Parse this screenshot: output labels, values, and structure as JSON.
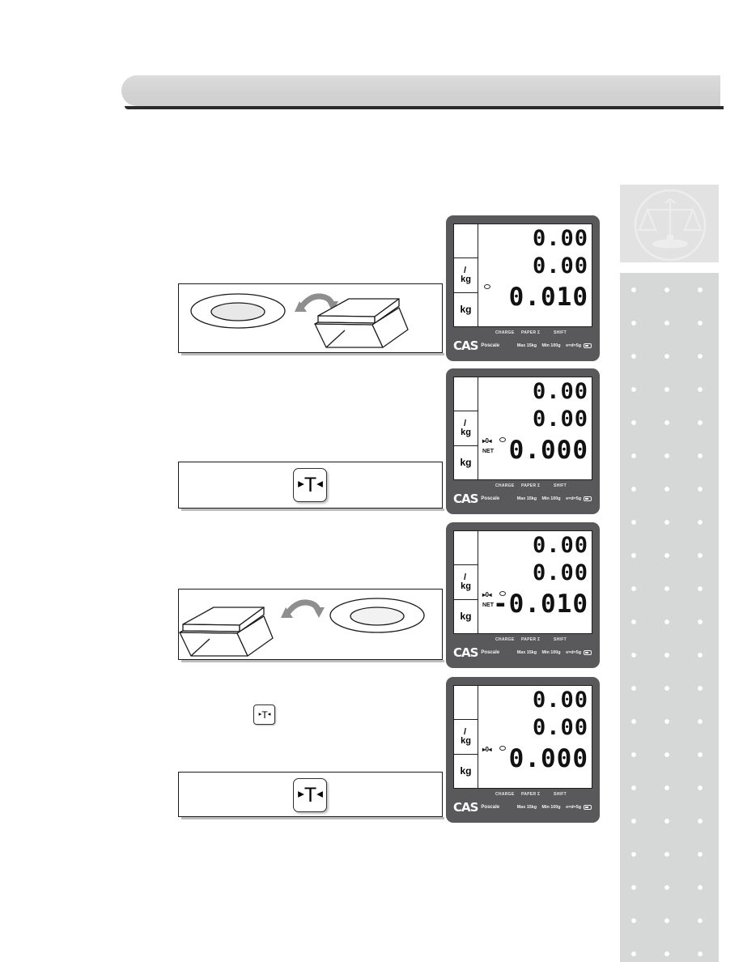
{
  "page": {
    "background_color": "#ffffff",
    "header_bar_color": "#d4d4d4",
    "sidebar_dot_color": "#ffffff",
    "sidebar_background_color": "#d6d8d8"
  },
  "sidebar": {
    "icon_name": "balance-scale-icon",
    "panel_color": "#e2e2e2"
  },
  "steps": [
    {
      "id": "step-1",
      "illustration": "plate-placed-onto-scale",
      "arrow": "curved-arrow-right"
    },
    {
      "id": "step-2",
      "key_label_left": "▸",
      "key_label_center": "T",
      "key_label_right": "◂"
    },
    {
      "id": "step-3",
      "illustration": "plate-removed-from-scale",
      "arrow": "curved-arrow-right"
    },
    {
      "id": "step-4",
      "key_label_left": "▸",
      "key_label_center": "T",
      "key_label_right": "◂"
    }
  ],
  "tare_key_small": {
    "label_left": "▸",
    "label_center": "T",
    "label_right": "◂"
  },
  "scales": [
    {
      "id": "scale-display-1",
      "units": {
        "top": "",
        "middle_slash": "/",
        "middle": "kg",
        "bottom": "kg"
      },
      "price_total": "0.00",
      "unit_price": "0.00",
      "weight": "0.010",
      "indicator_zero": "",
      "indicator_net": "",
      "indicator_stable": true,
      "function_labels": {
        "charge": "CHARGE",
        "paper": "PAPER",
        "sigma": "Σ",
        "shift": "SHIFT"
      },
      "brand": "CAS",
      "model": "Poscale",
      "spec_max": "Max 15kg",
      "spec_min": "Min 100g",
      "spec_ed": "e=d=5g"
    },
    {
      "id": "scale-display-2",
      "units": {
        "top": "",
        "middle_slash": "/",
        "middle": "kg",
        "bottom": "kg"
      },
      "price_total": "0.00",
      "unit_price": "0.00",
      "weight": "0.000",
      "indicator_zero": "▸0◂",
      "indicator_net": "NET",
      "indicator_stable": true,
      "function_labels": {
        "charge": "CHARGE",
        "paper": "PAPER",
        "sigma": "Σ",
        "shift": "SHIFT"
      },
      "brand": "CAS",
      "model": "Poscale",
      "spec_max": "Max 15kg",
      "spec_min": "Min 100g",
      "spec_ed": "e=d=5g"
    },
    {
      "id": "scale-display-3",
      "units": {
        "top": "",
        "middle_slash": "/",
        "middle": "kg",
        "bottom": "kg"
      },
      "price_total": "0.00",
      "unit_price": "0.00",
      "weight": "-0.010",
      "indicator_zero": "▸0◂",
      "indicator_net": "NET",
      "indicator_stable": true,
      "function_labels": {
        "charge": "CHARGE",
        "paper": "PAPER",
        "sigma": "Σ",
        "shift": "SHIFT"
      },
      "brand": "CAS",
      "model": "Poscale",
      "spec_max": "Max 15kg",
      "spec_min": "Min 100g",
      "spec_ed": "e=d=5g"
    },
    {
      "id": "scale-display-4",
      "units": {
        "top": "",
        "middle_slash": "/",
        "middle": "kg",
        "bottom": "kg"
      },
      "price_total": "0.00",
      "unit_price": "0.00",
      "weight": "0.000",
      "indicator_zero": "▸0◂",
      "indicator_net": "",
      "indicator_stable": true,
      "function_labels": {
        "charge": "CHARGE",
        "paper": "PAPER",
        "sigma": "Σ",
        "shift": "SHIFT"
      },
      "brand": "CAS",
      "model": "Poscale",
      "spec_max": "Max 15kg",
      "spec_min": "Min 100g",
      "spec_ed": "e=d=5g"
    }
  ]
}
